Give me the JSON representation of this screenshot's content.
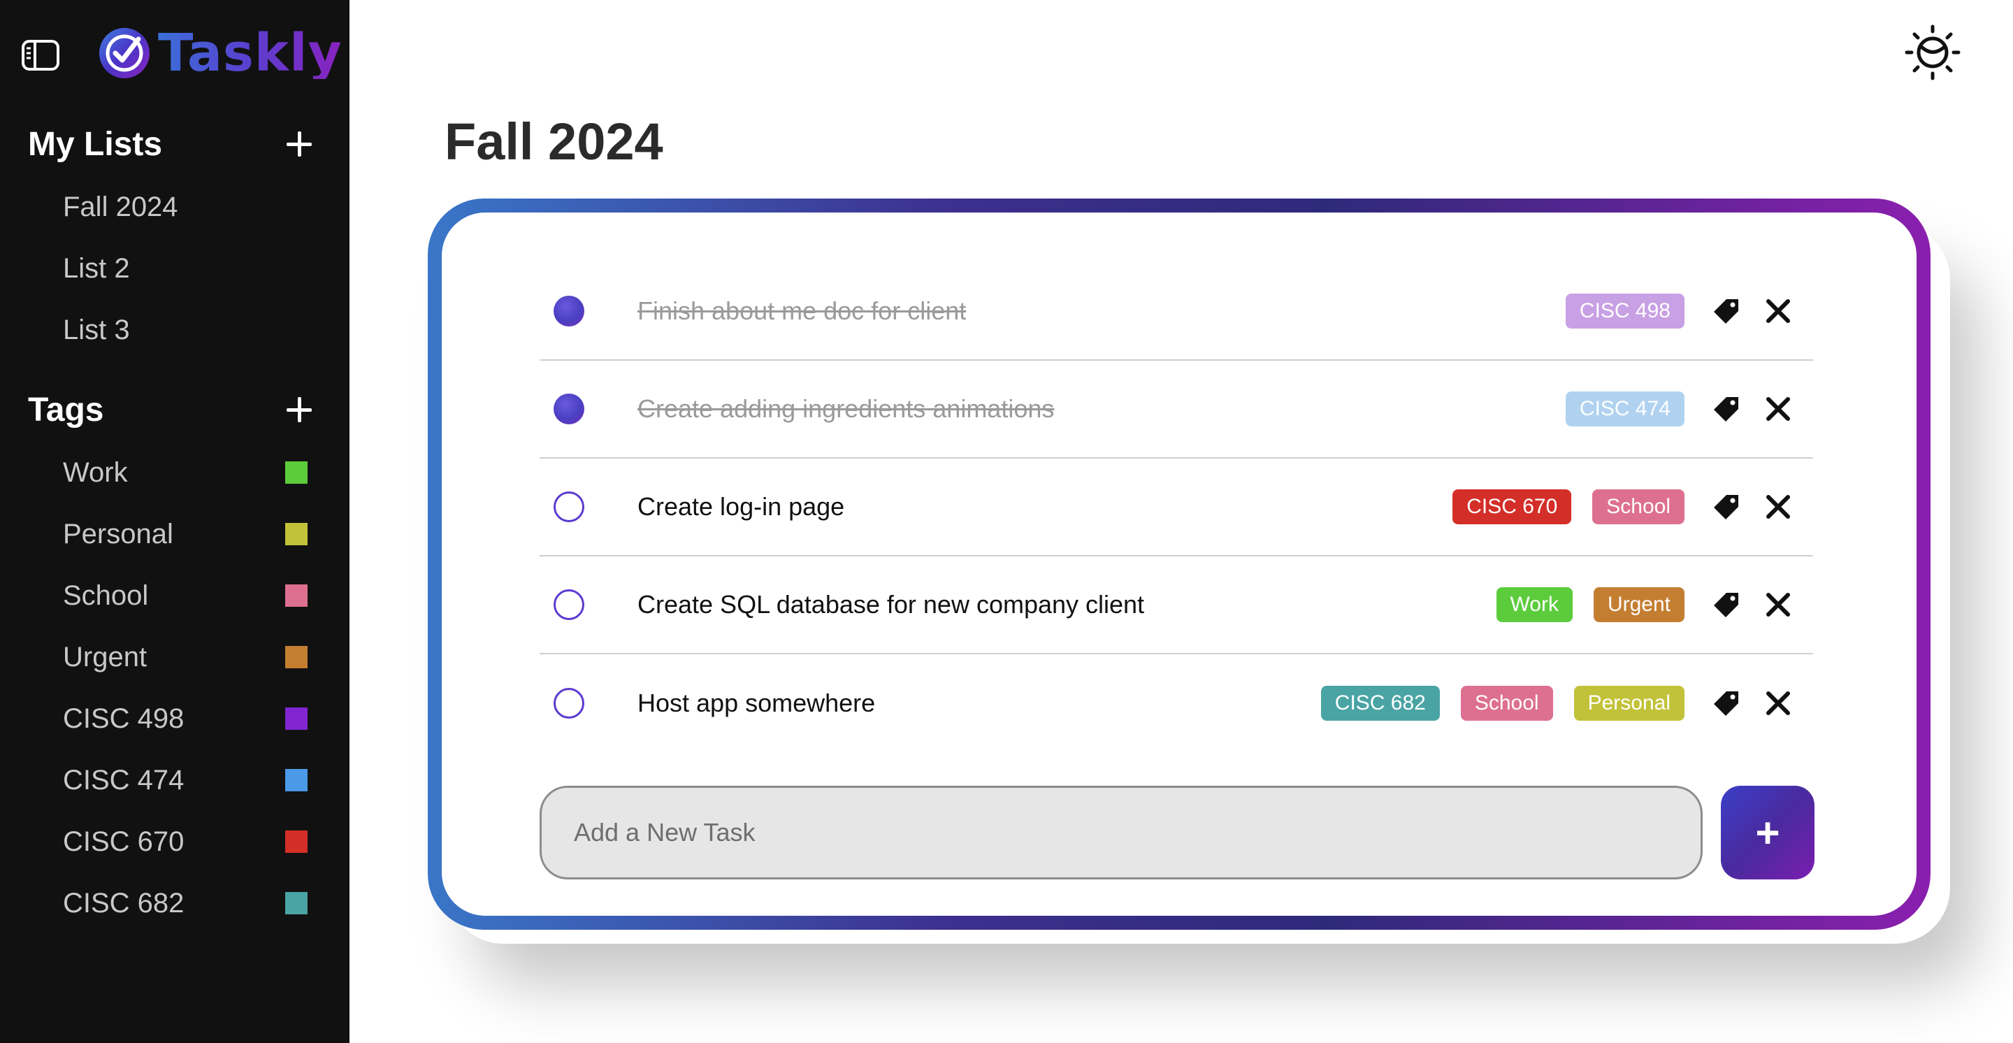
{
  "app": {
    "name": "Taskly",
    "logo_icon": "checkmark-circle-icon",
    "sidebar_toggle_icon": "sidebar-toggle-icon",
    "theme_icon": "sun-moon-icon",
    "accent_gradient": [
      "#3a76c8",
      "#2e2a7a",
      "#8a1fae"
    ]
  },
  "sidebar": {
    "lists_header": "My Lists",
    "lists": [
      {
        "label": "Fall 2024"
      },
      {
        "label": "List 2"
      },
      {
        "label": "List 3"
      }
    ],
    "tags_header": "Tags",
    "tags": [
      {
        "label": "Work",
        "color": "#5ccc3c"
      },
      {
        "label": "Personal",
        "color": "#c2c23a"
      },
      {
        "label": "School",
        "color": "#dd7090"
      },
      {
        "label": "Urgent",
        "color": "#c47e32"
      },
      {
        "label": "CISC 498",
        "color": "#8025d0"
      },
      {
        "label": "CISC 474",
        "color": "#4a9ae8"
      },
      {
        "label": "CISC 670",
        "color": "#d42e28"
      },
      {
        "label": "CISC 682",
        "color": "#4aa4a4"
      }
    ]
  },
  "main": {
    "title": "Fall 2024",
    "tasks": [
      {
        "text": "Finish about me doc for client",
        "done": true,
        "tags": [
          {
            "label": "CISC 498",
            "color": "#c8a0e4"
          }
        ]
      },
      {
        "text": "Create adding ingredients animations",
        "done": true,
        "tags": [
          {
            "label": "CISC 474",
            "color": "#b0d2f0"
          }
        ]
      },
      {
        "text": "Create log-in page",
        "done": false,
        "tags": [
          {
            "label": "CISC 670",
            "color": "#d42e28"
          },
          {
            "label": "School",
            "color": "#dd7090"
          }
        ]
      },
      {
        "text": "Create SQL database for new company client",
        "done": false,
        "tags": [
          {
            "label": "Work",
            "color": "#5ccc3c"
          },
          {
            "label": "Urgent",
            "color": "#c47e32"
          }
        ]
      },
      {
        "text": "Host app somewhere",
        "done": false,
        "tags": [
          {
            "label": "CISC 682",
            "color": "#4aa4a4"
          },
          {
            "label": "School",
            "color": "#dd7090"
          },
          {
            "label": "Personal",
            "color": "#c2c23a"
          }
        ]
      }
    ],
    "new_task": {
      "placeholder": "Add a New Task",
      "value": "",
      "add_label": "+"
    }
  }
}
